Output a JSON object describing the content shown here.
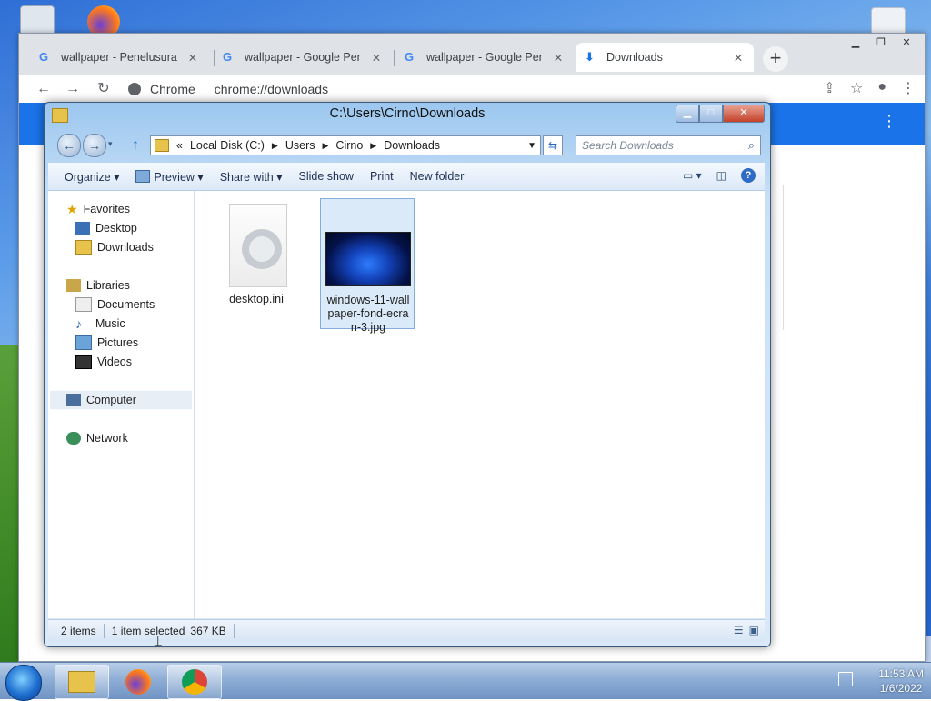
{
  "chrome": {
    "tabs": [
      {
        "label": "wallpaper - Penelusuran",
        "icon": "google-icon"
      },
      {
        "label": "wallpaper - Google Pene",
        "icon": "google-icon"
      },
      {
        "label": "wallpaper - Google Pene",
        "icon": "google-icon"
      },
      {
        "label": "Downloads",
        "icon": "download-icon"
      }
    ],
    "site_label": "Chrome",
    "url": "chrome://downloads"
  },
  "explorer": {
    "title": "C:\\Users\\Cirno\\Downloads",
    "breadcrumb": [
      "Local Disk (C:)",
      "Users",
      "Cirno",
      "Downloads"
    ],
    "breadcrumb_prefix": "«",
    "search_placeholder": "Search Downloads",
    "commands": [
      "Organize ▾",
      "Preview ▾",
      "Share with ▾",
      "Slide show",
      "Print",
      "New folder"
    ],
    "nav": {
      "favorites": "Favorites",
      "desktop": "Desktop",
      "downloads": "Downloads",
      "libraries": "Libraries",
      "documents": "Documents",
      "music": "Music",
      "pictures": "Pictures",
      "videos": "Videos",
      "computer": "Computer",
      "network": "Network"
    },
    "files": [
      {
        "name": "desktop.ini",
        "selected": false
      },
      {
        "name": "windows-11-wallpaper-fond-ecran-3.jpg",
        "name_lines": [
          "windows-11-wall",
          "paper-fond-ecra",
          "n-3.jpg"
        ],
        "selected": true
      }
    ],
    "status": {
      "items": "2 items",
      "selected": "1 item selected",
      "size": "367 KB"
    }
  },
  "taskbar": {
    "time": "11:53 AM",
    "date": "1/6/2022"
  },
  "colors": {
    "chrome_accent": "#1a73e8",
    "selection": "#dbeaf9"
  }
}
